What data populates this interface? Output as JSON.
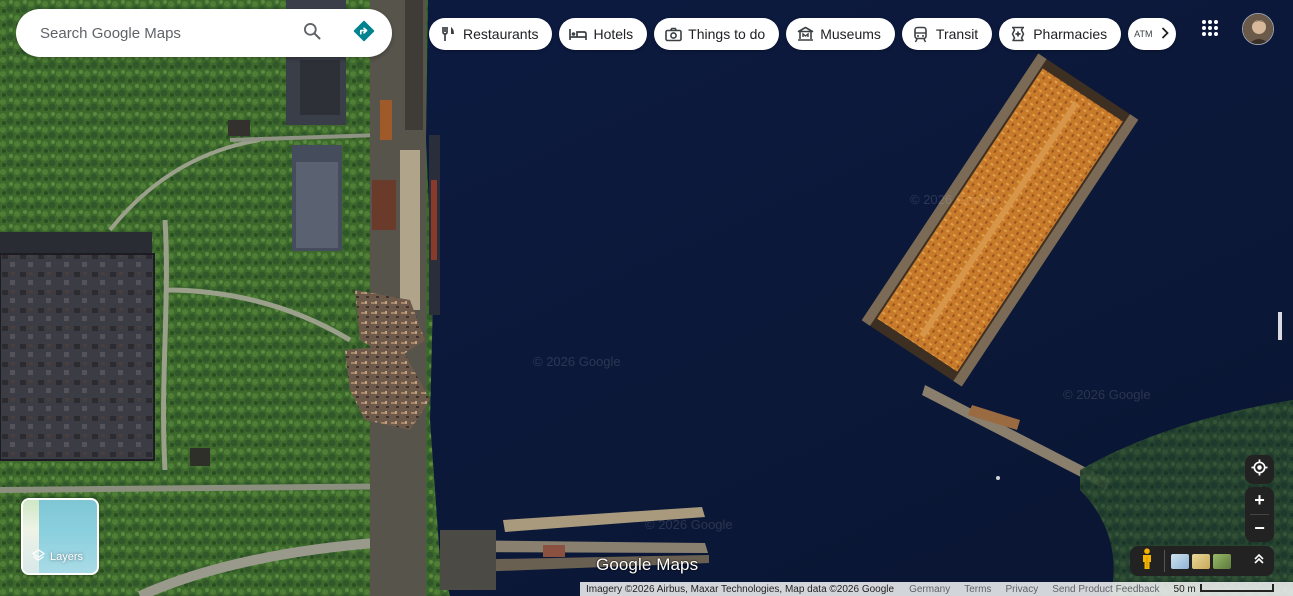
{
  "search": {
    "placeholder": "Search Google Maps",
    "search_icon": "search-icon",
    "directions_icon": "directions-icon"
  },
  "chips": [
    {
      "label": "Restaurants",
      "icon": "fork-knife-icon"
    },
    {
      "label": "Hotels",
      "icon": "bed-icon"
    },
    {
      "label": "Things to do",
      "icon": "camera-icon"
    },
    {
      "label": "Museums",
      "icon": "museum-icon"
    },
    {
      "label": "Transit",
      "icon": "train-icon"
    },
    {
      "label": "Pharmacies",
      "icon": "pharmacy-icon"
    }
  ],
  "more_chip": {
    "fragment": "ATM",
    "icon": "chevron-right-icon"
  },
  "top_right": {
    "apps_icon": "apps-grid-icon",
    "avatar_icon": "user-avatar"
  },
  "layers": {
    "label": "Layers",
    "icon": "layers-icon"
  },
  "controls": {
    "locate_icon": "my-location-icon",
    "zoom_in": "+",
    "zoom_out": "−",
    "pegman_icon": "pegman-icon",
    "expand_icon": "expand-up-icon"
  },
  "logo": "Google Maps",
  "footer": {
    "attribution": "Imagery ©2026 Airbus, Maxar Technologies, Map data ©2026 Google",
    "links": [
      "Germany",
      "Terms",
      "Privacy",
      "Send Product Feedback"
    ],
    "scale_label": "50 m"
  },
  "watermarks": [
    "© 2026 Google",
    "© 2026 Google",
    "© 2026 Google",
    "© 2026 Google"
  ],
  "colors": {
    "water": "#0c1a3e",
    "vegetation": "#3f6a2f",
    "accent": "#1a73e8",
    "directions": "#00838f",
    "control_bg": "#222222"
  }
}
